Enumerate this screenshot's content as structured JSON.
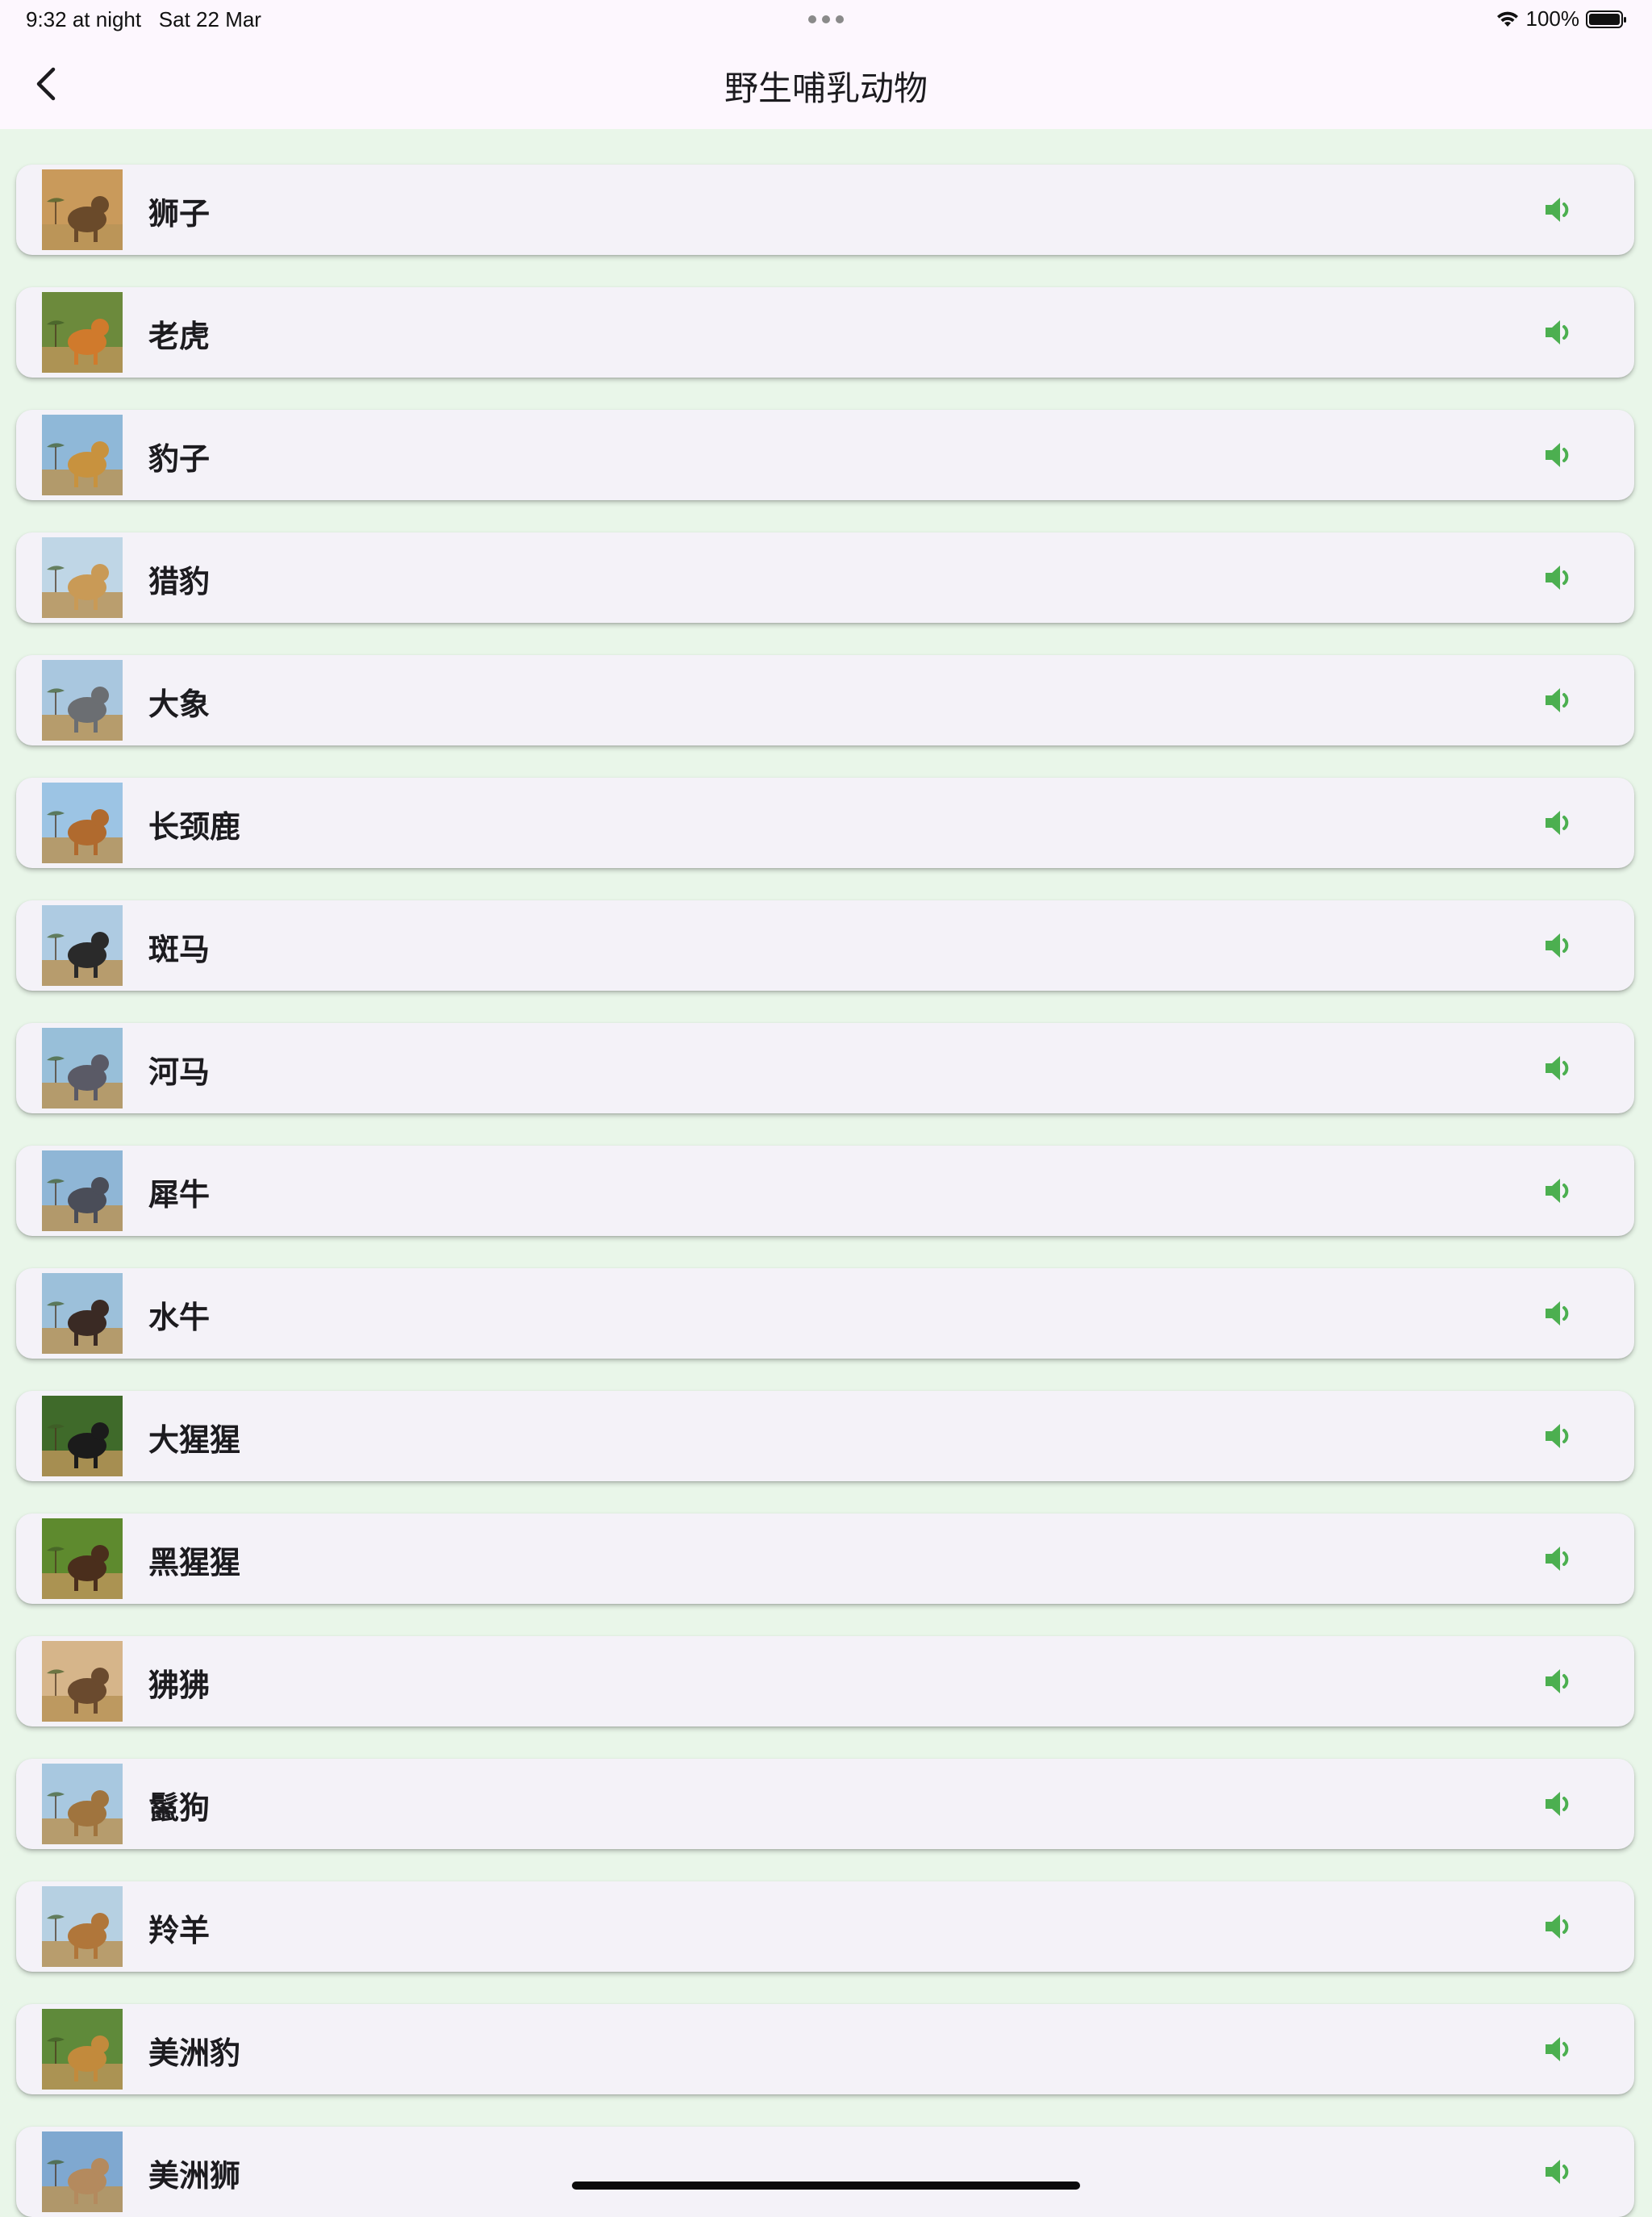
{
  "status_bar": {
    "time": "9:32 at night",
    "date": "Sat 22 Mar",
    "battery": "100%",
    "icons": [
      "wifi-icon",
      "battery-icon",
      "more-dots-icon"
    ]
  },
  "app_bar": {
    "title": "野生哺乳动物",
    "back_icon": "chevron-left-icon"
  },
  "colors": {
    "background": "#e9f6e9",
    "card": "#f4f2f8",
    "app_bar": "#fdf7fe",
    "speaker": "#4caf50"
  },
  "animals": [
    {
      "name": "狮子",
      "image": "lion-photo",
      "tone": [
        "#c99a5b",
        "#6a4a2a"
      ]
    },
    {
      "name": "老虎",
      "image": "tiger-photo",
      "tone": [
        "#6c8a3c",
        "#d07a2c"
      ]
    },
    {
      "name": "豹子",
      "image": "leopard-photo",
      "tone": [
        "#8fb8d8",
        "#c8923e"
      ]
    },
    {
      "name": "猎豹",
      "image": "cheetah-photo",
      "tone": [
        "#bfd6e6",
        "#c99a56"
      ]
    },
    {
      "name": "大象",
      "image": "elephant-photo",
      "tone": [
        "#a9c7df",
        "#6b6e72"
      ]
    },
    {
      "name": "长颈鹿",
      "image": "giraffe-photo",
      "tone": [
        "#9cc4e4",
        "#b06a2e"
      ]
    },
    {
      "name": "斑马",
      "image": "zebra-photo",
      "tone": [
        "#aecbe2",
        "#2a2a2a"
      ]
    },
    {
      "name": "河马",
      "image": "hippo-photo",
      "tone": [
        "#98bfd9",
        "#5a5a66"
      ]
    },
    {
      "name": "犀牛",
      "image": "rhino-photo",
      "tone": [
        "#8fb6d6",
        "#4a4d58"
      ]
    },
    {
      "name": "水牛",
      "image": "buffalo-photo",
      "tone": [
        "#9cc0da",
        "#3a2a24"
      ]
    },
    {
      "name": "大猩猩",
      "image": "gorilla-photo",
      "tone": [
        "#3f6a2a",
        "#1b1b1b"
      ]
    },
    {
      "name": "黑猩猩",
      "image": "chimpanzee-photo",
      "tone": [
        "#5e8a2e",
        "#4a2e1c"
      ]
    },
    {
      "name": "狒狒",
      "image": "baboon-photo",
      "tone": [
        "#d6b58a",
        "#6a4a2e"
      ]
    },
    {
      "name": "鬣狗",
      "image": "hyena-photo",
      "tone": [
        "#a8c8e0",
        "#a0743e"
      ]
    },
    {
      "name": "羚羊",
      "image": "antelope-photo",
      "tone": [
        "#b6d0e2",
        "#b0763a"
      ]
    },
    {
      "name": "美洲豹",
      "image": "jaguar-photo",
      "tone": [
        "#5f8a3a",
        "#c28a3c"
      ]
    },
    {
      "name": "美洲狮",
      "image": "cougar-photo",
      "tone": [
        "#7fa8d0",
        "#b48a5e"
      ]
    }
  ]
}
